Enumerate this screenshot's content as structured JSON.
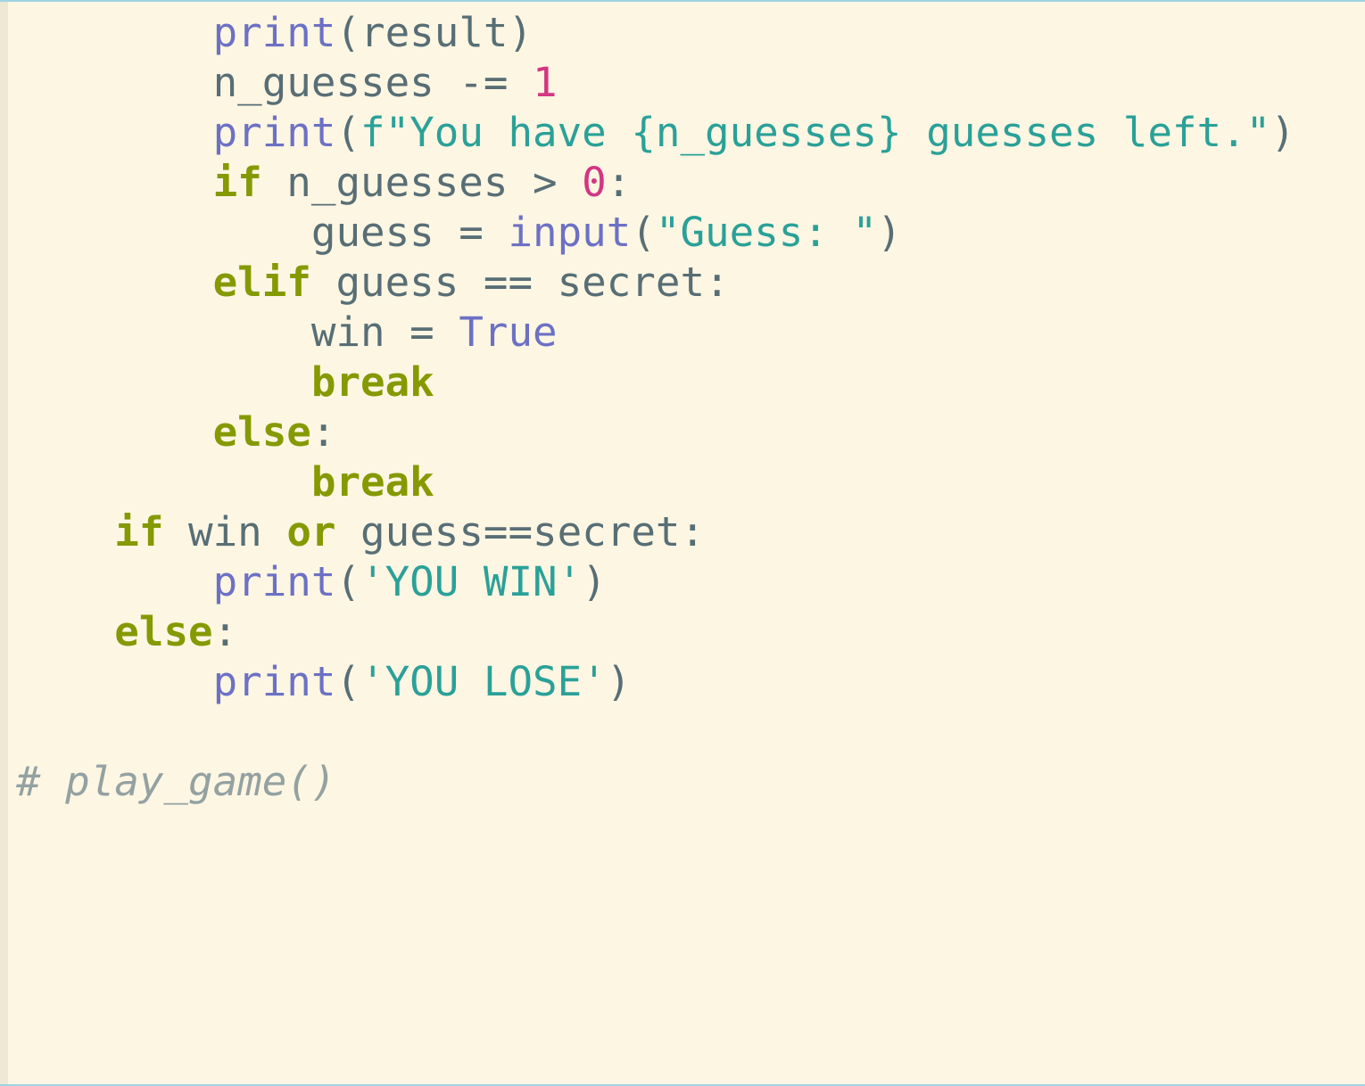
{
  "colors": {
    "background": "#fdf6e3",
    "gutter": "#eee8d5",
    "text": "#586e75",
    "keyword": "#859900",
    "builtin": "#6c71c4",
    "number": "#d33682",
    "string": "#2aa198",
    "comment": "#93a1a1"
  },
  "lines": [
    {
      "indent": "        ",
      "tokens": [
        {
          "t": "fn",
          "v": "print"
        },
        {
          "t": "plain",
          "v": "(result)"
        }
      ]
    },
    {
      "indent": "        ",
      "tokens": [
        {
          "t": "plain",
          "v": "n_guesses -= "
        },
        {
          "t": "num",
          "v": "1"
        }
      ]
    },
    {
      "indent": "        ",
      "tokens": [
        {
          "t": "fn",
          "v": "print"
        },
        {
          "t": "plain",
          "v": "("
        },
        {
          "t": "str",
          "v": "f\"You have {n_guesses} guesses left.\""
        },
        {
          "t": "plain",
          "v": ")"
        }
      ]
    },
    {
      "indent": "        ",
      "tokens": [
        {
          "t": "kw",
          "v": "if"
        },
        {
          "t": "plain",
          "v": " n_guesses > "
        },
        {
          "t": "num",
          "v": "0"
        },
        {
          "t": "plain",
          "v": ":"
        }
      ]
    },
    {
      "indent": "            ",
      "tokens": [
        {
          "t": "plain",
          "v": "guess = "
        },
        {
          "t": "fn",
          "v": "input"
        },
        {
          "t": "plain",
          "v": "("
        },
        {
          "t": "str",
          "v": "\"Guess: \""
        },
        {
          "t": "plain",
          "v": ")"
        }
      ]
    },
    {
      "indent": "        ",
      "tokens": [
        {
          "t": "kw",
          "v": "elif"
        },
        {
          "t": "plain",
          "v": " guess == secret:"
        }
      ]
    },
    {
      "indent": "            ",
      "tokens": [
        {
          "t": "plain",
          "v": "win = "
        },
        {
          "t": "fn",
          "v": "True"
        }
      ]
    },
    {
      "indent": "            ",
      "tokens": [
        {
          "t": "kw",
          "v": "break"
        }
      ]
    },
    {
      "indent": "        ",
      "tokens": [
        {
          "t": "kw",
          "v": "else"
        },
        {
          "t": "plain",
          "v": ":"
        }
      ]
    },
    {
      "indent": "            ",
      "tokens": [
        {
          "t": "kw",
          "v": "break"
        }
      ]
    },
    {
      "indent": "    ",
      "tokens": [
        {
          "t": "kw",
          "v": "if"
        },
        {
          "t": "plain",
          "v": " win "
        },
        {
          "t": "kw",
          "v": "or"
        },
        {
          "t": "plain",
          "v": " guess==secret:"
        }
      ]
    },
    {
      "indent": "        ",
      "tokens": [
        {
          "t": "fn",
          "v": "print"
        },
        {
          "t": "plain",
          "v": "("
        },
        {
          "t": "str",
          "v": "'YOU WIN'"
        },
        {
          "t": "plain",
          "v": ")"
        }
      ]
    },
    {
      "indent": "    ",
      "tokens": [
        {
          "t": "kw",
          "v": "else"
        },
        {
          "t": "plain",
          "v": ":"
        }
      ]
    },
    {
      "indent": "        ",
      "tokens": [
        {
          "t": "fn",
          "v": "print"
        },
        {
          "t": "plain",
          "v": "("
        },
        {
          "t": "str",
          "v": "'YOU LOSE'"
        },
        {
          "t": "plain",
          "v": ")"
        }
      ]
    },
    {
      "indent": "",
      "tokens": []
    },
    {
      "indent": "",
      "tokens": [
        {
          "t": "cmt",
          "v": "# play_game()"
        }
      ]
    }
  ]
}
